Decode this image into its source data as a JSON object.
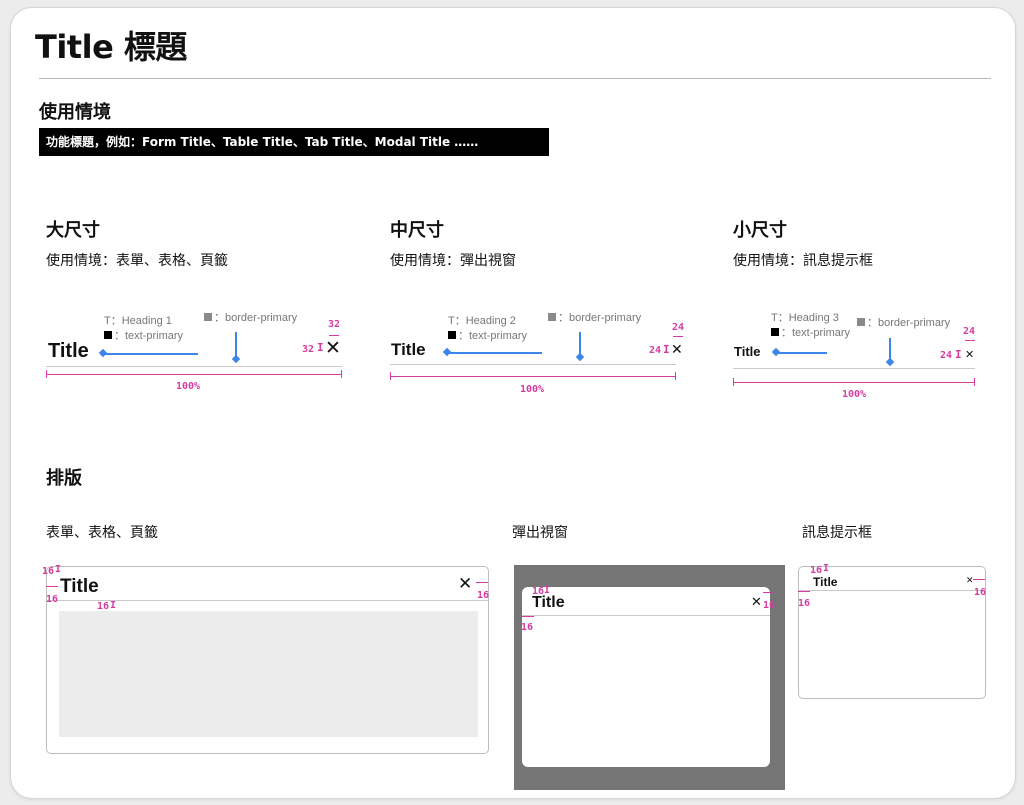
{
  "page": {
    "title": "Title 標題"
  },
  "usage": {
    "heading": "使用情境",
    "banner": "功能標題，例如：Form Title、Table Title、Tab Title、Modal Title ……"
  },
  "sizes": [
    {
      "heading": "大尺寸",
      "usage": "使用情境：表單、表格、頁籤",
      "text_style": "T：Heading 1",
      "text_color": "■：text-primary",
      "border_color": "■：border-primary",
      "sample": "Title",
      "icon_size": "32",
      "width_label": "100%"
    },
    {
      "heading": "中尺寸",
      "usage": "使用情境：彈出視窗",
      "text_style": "T：Heading 2",
      "text_color": "■：text-primary",
      "border_color": "■：border-primary",
      "sample": "Title",
      "icon_size": "24",
      "width_label": "100%"
    },
    {
      "heading": "小尺寸",
      "usage": "使用情境：訊息提示框",
      "text_style": "T：Heading 3",
      "text_color": "■：text-primary",
      "border_color": "■：border-primary",
      "sample": "Title",
      "icon_size": "24",
      "width_label": "100%"
    }
  ],
  "layout": {
    "heading": "排版",
    "examples": [
      {
        "label": "表單、表格、頁籤",
        "sample": "Title",
        "spacing": "16"
      },
      {
        "label": "彈出視窗",
        "sample": "Title",
        "spacing": "16"
      },
      {
        "label": "訊息提示框",
        "sample": "Title",
        "spacing": "16"
      }
    ]
  },
  "colors": {
    "accent_blue": "#3d85e8",
    "measure_pink": "#d63ca0",
    "banner_bg": "#000000",
    "modal_overlay": "#757575",
    "content_placeholder": "#ececec"
  },
  "icons": {
    "close": "close-icon"
  }
}
